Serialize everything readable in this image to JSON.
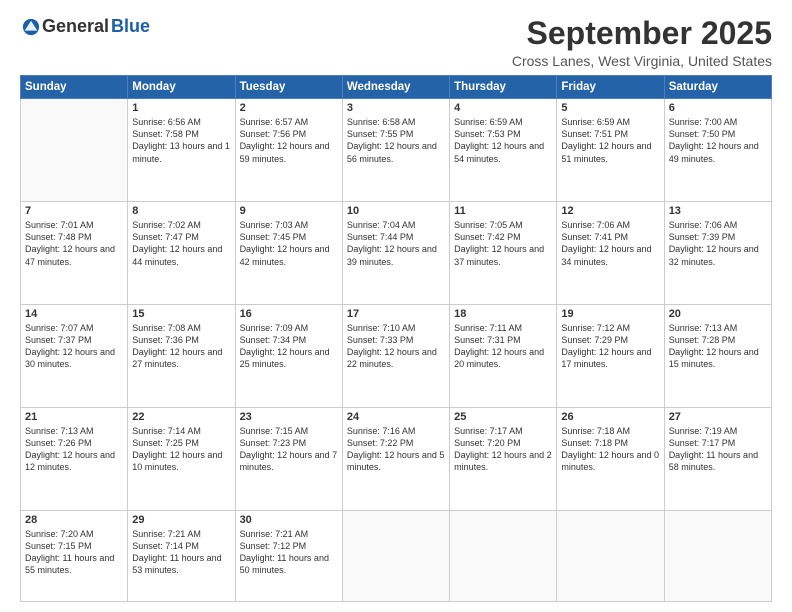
{
  "logo": {
    "general": "General",
    "blue": "Blue"
  },
  "title": "September 2025",
  "location": "Cross Lanes, West Virginia, United States",
  "days_header": [
    "Sunday",
    "Monday",
    "Tuesday",
    "Wednesday",
    "Thursday",
    "Friday",
    "Saturday"
  ],
  "weeks": [
    [
      {
        "day": "",
        "sunrise": "",
        "sunset": "",
        "daylight": ""
      },
      {
        "day": "1",
        "sunrise": "Sunrise: 6:56 AM",
        "sunset": "Sunset: 7:58 PM",
        "daylight": "Daylight: 13 hours and 1 minute."
      },
      {
        "day": "2",
        "sunrise": "Sunrise: 6:57 AM",
        "sunset": "Sunset: 7:56 PM",
        "daylight": "Daylight: 12 hours and 59 minutes."
      },
      {
        "day": "3",
        "sunrise": "Sunrise: 6:58 AM",
        "sunset": "Sunset: 7:55 PM",
        "daylight": "Daylight: 12 hours and 56 minutes."
      },
      {
        "day": "4",
        "sunrise": "Sunrise: 6:59 AM",
        "sunset": "Sunset: 7:53 PM",
        "daylight": "Daylight: 12 hours and 54 minutes."
      },
      {
        "day": "5",
        "sunrise": "Sunrise: 6:59 AM",
        "sunset": "Sunset: 7:51 PM",
        "daylight": "Daylight: 12 hours and 51 minutes."
      },
      {
        "day": "6",
        "sunrise": "Sunrise: 7:00 AM",
        "sunset": "Sunset: 7:50 PM",
        "daylight": "Daylight: 12 hours and 49 minutes."
      }
    ],
    [
      {
        "day": "7",
        "sunrise": "Sunrise: 7:01 AM",
        "sunset": "Sunset: 7:48 PM",
        "daylight": "Daylight: 12 hours and 47 minutes."
      },
      {
        "day": "8",
        "sunrise": "Sunrise: 7:02 AM",
        "sunset": "Sunset: 7:47 PM",
        "daylight": "Daylight: 12 hours and 44 minutes."
      },
      {
        "day": "9",
        "sunrise": "Sunrise: 7:03 AM",
        "sunset": "Sunset: 7:45 PM",
        "daylight": "Daylight: 12 hours and 42 minutes."
      },
      {
        "day": "10",
        "sunrise": "Sunrise: 7:04 AM",
        "sunset": "Sunset: 7:44 PM",
        "daylight": "Daylight: 12 hours and 39 minutes."
      },
      {
        "day": "11",
        "sunrise": "Sunrise: 7:05 AM",
        "sunset": "Sunset: 7:42 PM",
        "daylight": "Daylight: 12 hours and 37 minutes."
      },
      {
        "day": "12",
        "sunrise": "Sunrise: 7:06 AM",
        "sunset": "Sunset: 7:41 PM",
        "daylight": "Daylight: 12 hours and 34 minutes."
      },
      {
        "day": "13",
        "sunrise": "Sunrise: 7:06 AM",
        "sunset": "Sunset: 7:39 PM",
        "daylight": "Daylight: 12 hours and 32 minutes."
      }
    ],
    [
      {
        "day": "14",
        "sunrise": "Sunrise: 7:07 AM",
        "sunset": "Sunset: 7:37 PM",
        "daylight": "Daylight: 12 hours and 30 minutes."
      },
      {
        "day": "15",
        "sunrise": "Sunrise: 7:08 AM",
        "sunset": "Sunset: 7:36 PM",
        "daylight": "Daylight: 12 hours and 27 minutes."
      },
      {
        "day": "16",
        "sunrise": "Sunrise: 7:09 AM",
        "sunset": "Sunset: 7:34 PM",
        "daylight": "Daylight: 12 hours and 25 minutes."
      },
      {
        "day": "17",
        "sunrise": "Sunrise: 7:10 AM",
        "sunset": "Sunset: 7:33 PM",
        "daylight": "Daylight: 12 hours and 22 minutes."
      },
      {
        "day": "18",
        "sunrise": "Sunrise: 7:11 AM",
        "sunset": "Sunset: 7:31 PM",
        "daylight": "Daylight: 12 hours and 20 minutes."
      },
      {
        "day": "19",
        "sunrise": "Sunrise: 7:12 AM",
        "sunset": "Sunset: 7:29 PM",
        "daylight": "Daylight: 12 hours and 17 minutes."
      },
      {
        "day": "20",
        "sunrise": "Sunrise: 7:13 AM",
        "sunset": "Sunset: 7:28 PM",
        "daylight": "Daylight: 12 hours and 15 minutes."
      }
    ],
    [
      {
        "day": "21",
        "sunrise": "Sunrise: 7:13 AM",
        "sunset": "Sunset: 7:26 PM",
        "daylight": "Daylight: 12 hours and 12 minutes."
      },
      {
        "day": "22",
        "sunrise": "Sunrise: 7:14 AM",
        "sunset": "Sunset: 7:25 PM",
        "daylight": "Daylight: 12 hours and 10 minutes."
      },
      {
        "day": "23",
        "sunrise": "Sunrise: 7:15 AM",
        "sunset": "Sunset: 7:23 PM",
        "daylight": "Daylight: 12 hours and 7 minutes."
      },
      {
        "day": "24",
        "sunrise": "Sunrise: 7:16 AM",
        "sunset": "Sunset: 7:22 PM",
        "daylight": "Daylight: 12 hours and 5 minutes."
      },
      {
        "day": "25",
        "sunrise": "Sunrise: 7:17 AM",
        "sunset": "Sunset: 7:20 PM",
        "daylight": "Daylight: 12 hours and 2 minutes."
      },
      {
        "day": "26",
        "sunrise": "Sunrise: 7:18 AM",
        "sunset": "Sunset: 7:18 PM",
        "daylight": "Daylight: 12 hours and 0 minutes."
      },
      {
        "day": "27",
        "sunrise": "Sunrise: 7:19 AM",
        "sunset": "Sunset: 7:17 PM",
        "daylight": "Daylight: 11 hours and 58 minutes."
      }
    ],
    [
      {
        "day": "28",
        "sunrise": "Sunrise: 7:20 AM",
        "sunset": "Sunset: 7:15 PM",
        "daylight": "Daylight: 11 hours and 55 minutes."
      },
      {
        "day": "29",
        "sunrise": "Sunrise: 7:21 AM",
        "sunset": "Sunset: 7:14 PM",
        "daylight": "Daylight: 11 hours and 53 minutes."
      },
      {
        "day": "30",
        "sunrise": "Sunrise: 7:21 AM",
        "sunset": "Sunset: 7:12 PM",
        "daylight": "Daylight: 11 hours and 50 minutes."
      },
      {
        "day": "",
        "sunrise": "",
        "sunset": "",
        "daylight": ""
      },
      {
        "day": "",
        "sunrise": "",
        "sunset": "",
        "daylight": ""
      },
      {
        "day": "",
        "sunrise": "",
        "sunset": "",
        "daylight": ""
      },
      {
        "day": "",
        "sunrise": "",
        "sunset": "",
        "daylight": ""
      }
    ]
  ]
}
